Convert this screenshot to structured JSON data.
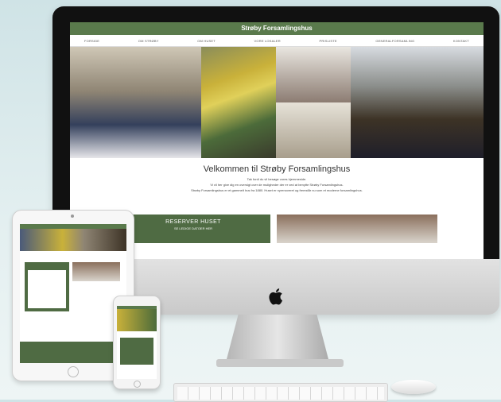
{
  "site": {
    "title": "Strøby Forsamlingshus",
    "nav": [
      "FORSIDE",
      "OM STRØBY",
      "OM HUSET",
      "VORE LOKALER",
      "PRISLISTE",
      "GENERALFORSAMLING",
      "KONTAKT"
    ],
    "welcome_heading": "Velkommen til Strøby Forsamlingshus",
    "welcome_lines": [
      "Tak fordi du vil besøge vores hjemmeside.",
      "Vi vil her give dig en oversigt over de muligheder der er ved at benytte Strøby Forsamlingshus.",
      "Strøby Forsamlingshus er et gammelt hus fra 1880. Huset er nyrenoveret og fremstår nu som et moderne forsamlingshus."
    ],
    "cta_title": "RESERVER HUSET",
    "cta_subtitle": "SE LEDIGE DATOER HER"
  },
  "colors": {
    "brand_green": "#5a7a4c",
    "cta_green": "#4f6b43"
  },
  "icons": {
    "apple_logo": "apple-logo-icon"
  }
}
